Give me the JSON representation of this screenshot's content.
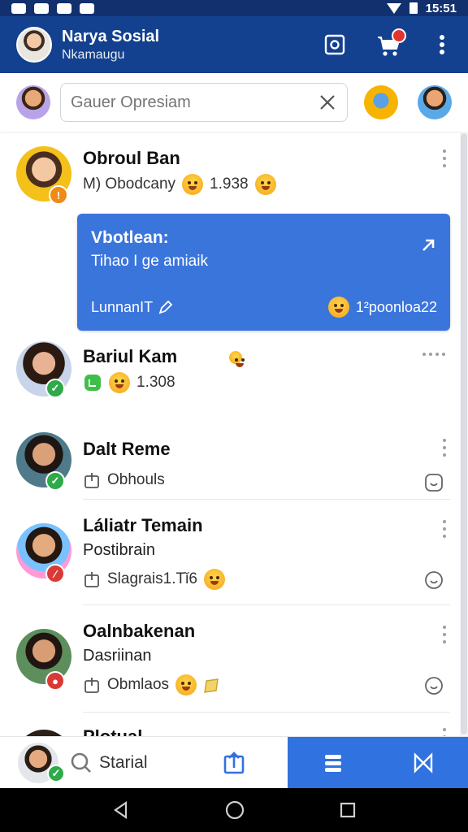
{
  "status_bar": {
    "time": "15:51"
  },
  "app_bar": {
    "title": "Narya Sosial",
    "subtitle": "Nkamaugu"
  },
  "search": {
    "placeholder": "Gauer Opresiam"
  },
  "chats": [
    {
      "name": "Obroul Ban",
      "preview": "M) Obodcany",
      "stat": "1.938",
      "status_color": "#ef8a17"
    },
    {
      "name": "Bariul Kam",
      "stat": "1.308",
      "status_color": "#2eaa49"
    },
    {
      "name": "Dalt Reme",
      "preview": "Obhouls",
      "status_color": "#2eaa49"
    },
    {
      "name": "Láliatr Temain",
      "subtitle": "Postibrain",
      "preview": "Slagrais1.Tǐ6",
      "status_color": "#d93a35"
    },
    {
      "name": "Oalnbakenan",
      "subtitle": "Dasriinan",
      "preview": "Obmlaos",
      "status_color": "#d93a35"
    },
    {
      "name": "Plotual"
    }
  ],
  "card": {
    "title": "Vbotlean:",
    "text": "Tihao I ge amiaik",
    "footer_left": "LunnanIT",
    "footer_right": "1²poonloa22"
  },
  "bottom_bar": {
    "label": "Starial"
  },
  "colors": {
    "primary": "#13418f",
    "accent": "#2f72e0",
    "online": "#2eaa49",
    "busy": "#d93a35"
  }
}
